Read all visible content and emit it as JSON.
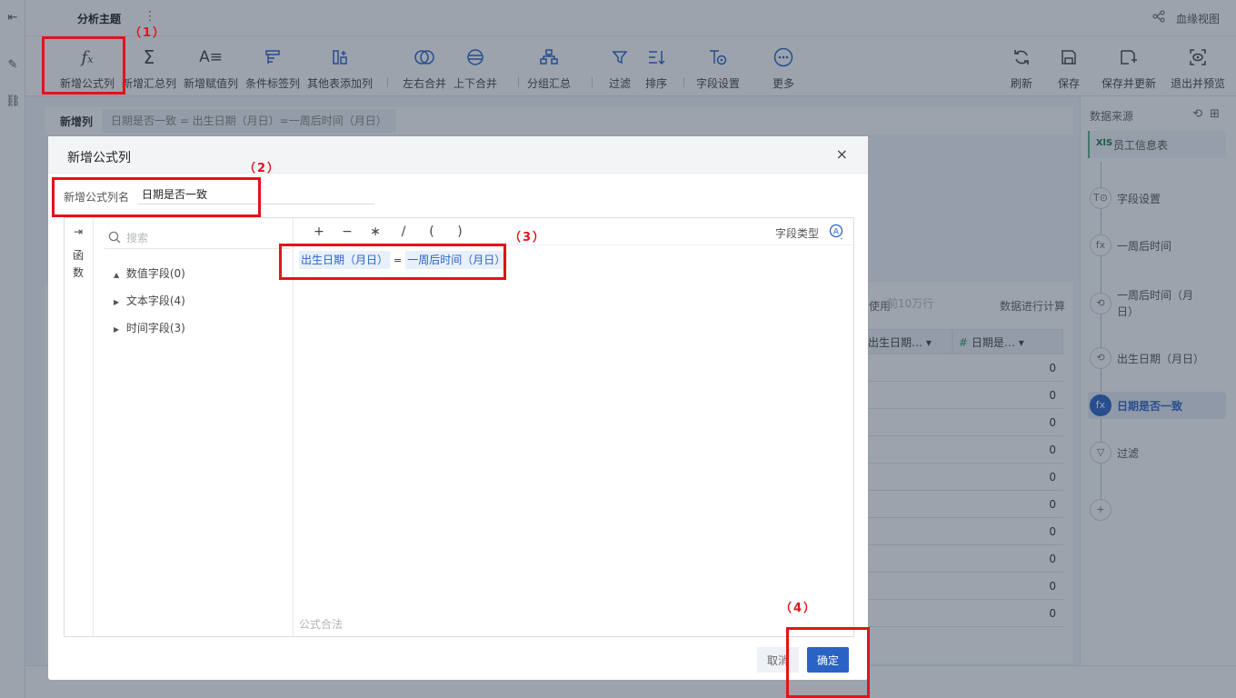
{
  "topbar": {
    "title": "分析主题",
    "kebab": "⋮",
    "lineage_label": "血缘视图"
  },
  "toolbar": {
    "items": [
      {
        "label": "新增公式列",
        "icon": "fx-icon"
      },
      {
        "label": "新增汇总列",
        "icon": "sigma-icon"
      },
      {
        "label": "新增赋值列",
        "icon": "assign-icon"
      },
      {
        "label": "条件标签列",
        "icon": "tag-icon"
      },
      {
        "label": "其他表添加列",
        "icon": "add-column-icon"
      },
      {
        "label": "左右合并",
        "icon": "merge-horizontal-icon"
      },
      {
        "label": "上下合并",
        "icon": "merge-vertical-icon"
      },
      {
        "label": "分组汇总",
        "icon": "group-icon"
      },
      {
        "label": "过滤",
        "icon": "filter-icon"
      },
      {
        "label": "排序",
        "icon": "sort-icon"
      },
      {
        "label": "字段设置",
        "icon": "field-settings-icon"
      },
      {
        "label": "更多",
        "icon": "more-icon"
      }
    ],
    "right_items": [
      {
        "label": "刷新",
        "icon": "refresh-icon"
      },
      {
        "label": "保存",
        "icon": "save-icon"
      },
      {
        "label": "保存并更新",
        "icon": "save-update-icon"
      },
      {
        "label": "退出并预览",
        "icon": "exit-preview-icon"
      }
    ]
  },
  "breadcrumb": {
    "label": "新增列",
    "formula": "日期是否一致 = 出生日期（月日）=一周后时间（月日）"
  },
  "data_area": {
    "hint_use": "使用",
    "row_limit": "前10万行",
    "hint_calc": "数据进行计算",
    "columns": [
      "出生日期…",
      "日期是…"
    ],
    "values": [
      "0",
      "0",
      "0",
      "0",
      "0",
      "0",
      "0",
      "0",
      "0",
      "0"
    ]
  },
  "right_panel": {
    "title": "数据来源",
    "steps": [
      {
        "label": "员工信息表",
        "icon": "XlS"
      },
      {
        "label": "字段设置",
        "icon": "T⊙"
      },
      {
        "label": "一周后时间",
        "icon": "fx"
      },
      {
        "label": "一周后时间（月",
        "label2": "日）",
        "icon": "⟲"
      },
      {
        "label": "出生日期（月日）",
        "icon": "⟲"
      },
      {
        "label": "日期是否一致",
        "icon": "fx"
      },
      {
        "label": "过滤",
        "icon": "▽"
      },
      {
        "label": "",
        "icon": "+"
      }
    ]
  },
  "modal": {
    "title": "新增公式列",
    "close": "×",
    "name_label": "新增公式列名",
    "name_value": "日期是否一致",
    "function_tab": "函数",
    "search_placeholder": "搜索",
    "tree": [
      {
        "label": "数值字段(0)",
        "caret": "▲"
      },
      {
        "label": "文本字段(4)",
        "caret": "▶"
      },
      {
        "label": "时间字段(3)",
        "caret": "▶"
      }
    ],
    "operators": [
      "+",
      "−",
      "∗",
      "/",
      "(",
      ")"
    ],
    "field_type_label": "字段类型",
    "formula": {
      "left": "出生日期（月日）",
      "op": "=",
      "right": "一周后时间（月日）"
    },
    "validation": "公式合法",
    "cancel": "取消",
    "ok": "确定"
  },
  "annotations": [
    "（1）",
    "（2）",
    "（3）",
    "（4）"
  ],
  "colors": {
    "accent": "#2a63c5",
    "annotation": "#e0141b"
  }
}
